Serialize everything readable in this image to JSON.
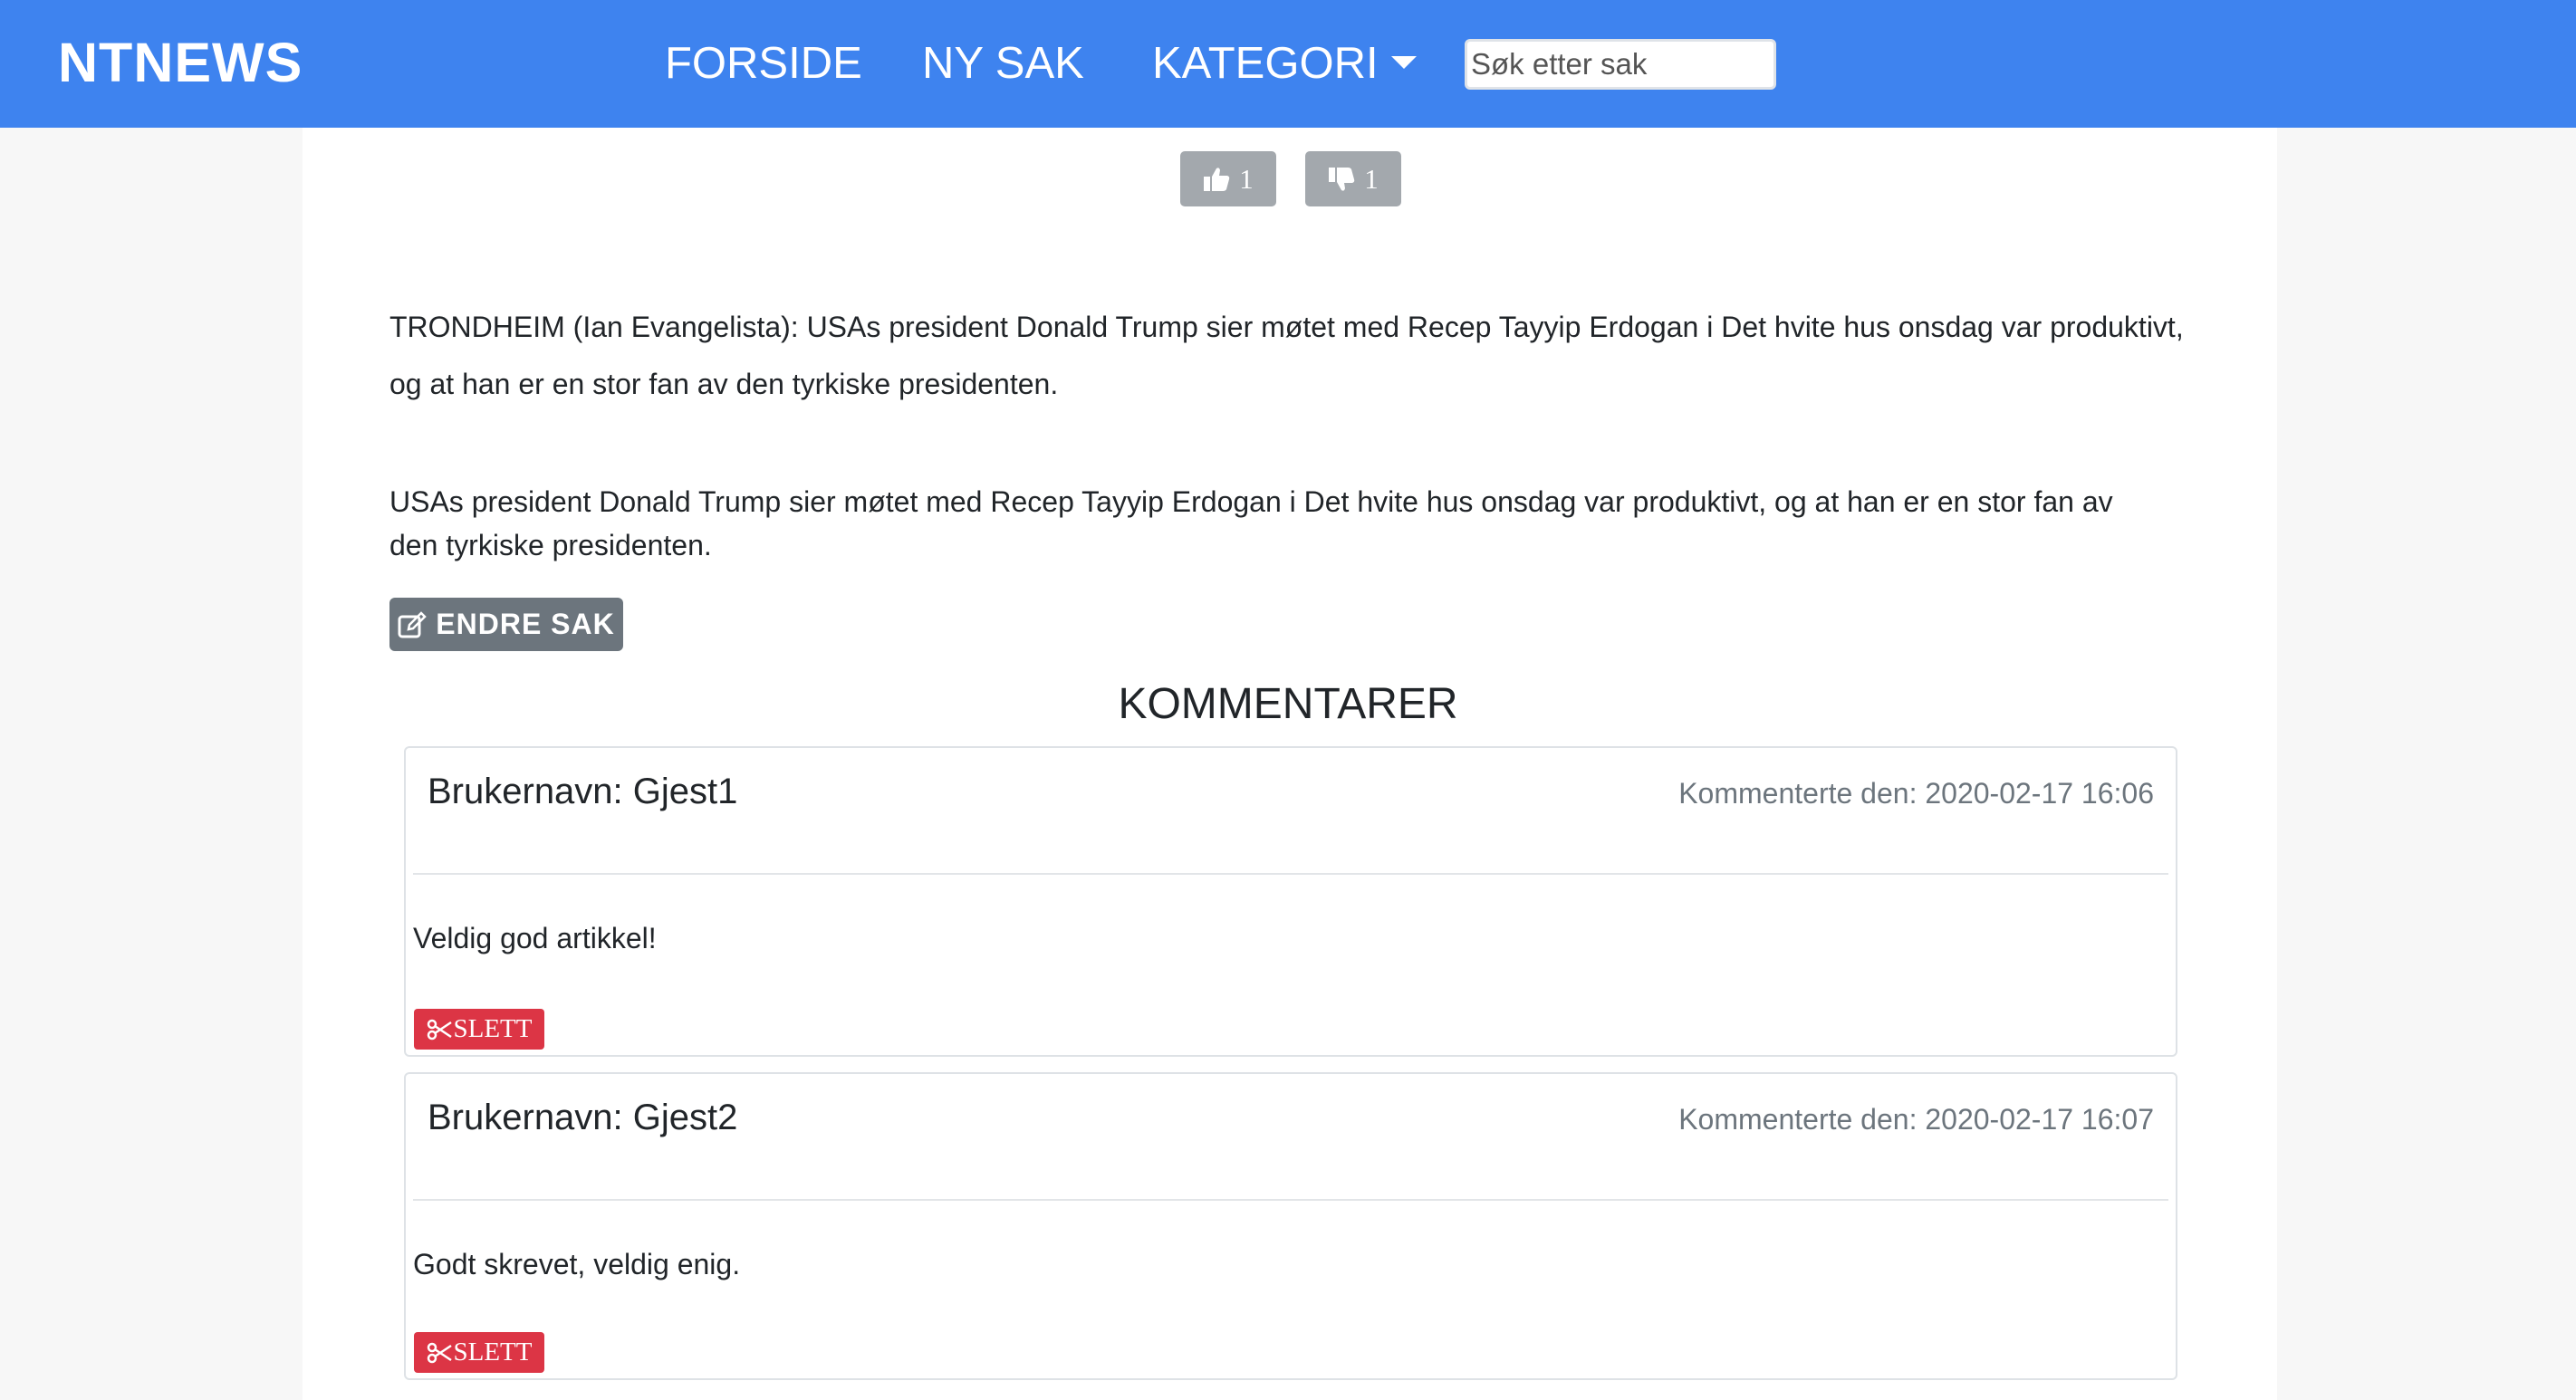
{
  "navbar": {
    "brand": "NTNEWS",
    "links": [
      "FORSIDE",
      "NY SAK",
      "KATEGORI"
    ],
    "search_placeholder": "Søk etter sak"
  },
  "votes": {
    "likes": "1",
    "dislikes": "1"
  },
  "article": {
    "lead": "TRONDHEIM (Ian Evangelista): USAs president Donald Trump sier møtet med Recep Tayyip Erdogan i Det hvite hus onsdag var produktivt, og at han er en stor fan av den tyrkiske presidenten.",
    "body": "USAs president Donald Trump sier møtet med Recep Tayyip Erdogan i Det hvite hus onsdag var produktivt, og at han er en stor fan av den tyrkiske presidenten.",
    "edit_label": "ENDRE SAK"
  },
  "comments": {
    "title": "KOMMENTARER",
    "items": [
      {
        "user": "Brukernavn: Gjest1",
        "date": "Kommenterte den: 2020-02-17 16:06",
        "text": "Veldig god artikkel!",
        "delete_label": "SLETT"
      },
      {
        "user": "Brukernavn: Gjest2",
        "date": "Kommenterte den: 2020-02-17 16:07",
        "text": "Godt skrevet, veldig enig.",
        "delete_label": "SLETT"
      }
    ]
  },
  "colors": {
    "navbar": "#3e83ef",
    "vote_button": "#a3a8ad",
    "edit_button": "#6c757d",
    "delete_button": "#dc3545"
  },
  "icons": [
    "thumbs-up-icon",
    "thumbs-down-icon",
    "edit-icon",
    "scissors-icon"
  ]
}
